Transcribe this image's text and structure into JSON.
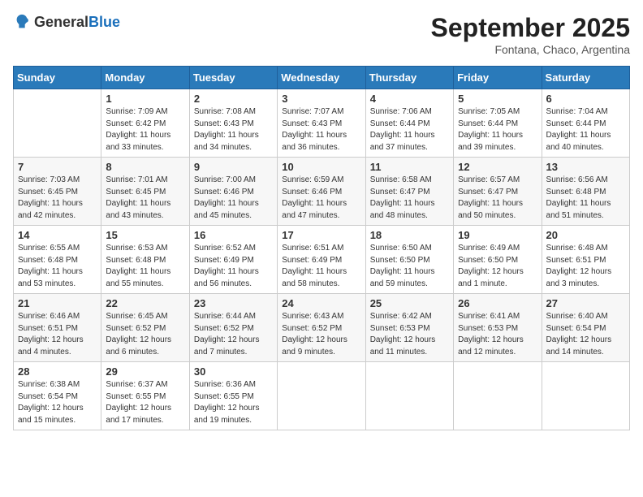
{
  "logo": {
    "general": "General",
    "blue": "Blue"
  },
  "title": "September 2025",
  "location": "Fontana, Chaco, Argentina",
  "days_of_week": [
    "Sunday",
    "Monday",
    "Tuesday",
    "Wednesday",
    "Thursday",
    "Friday",
    "Saturday"
  ],
  "weeks": [
    [
      {
        "day": "",
        "info": ""
      },
      {
        "day": "1",
        "info": "Sunrise: 7:09 AM\nSunset: 6:42 PM\nDaylight: 11 hours\nand 33 minutes."
      },
      {
        "day": "2",
        "info": "Sunrise: 7:08 AM\nSunset: 6:43 PM\nDaylight: 11 hours\nand 34 minutes."
      },
      {
        "day": "3",
        "info": "Sunrise: 7:07 AM\nSunset: 6:43 PM\nDaylight: 11 hours\nand 36 minutes."
      },
      {
        "day": "4",
        "info": "Sunrise: 7:06 AM\nSunset: 6:44 PM\nDaylight: 11 hours\nand 37 minutes."
      },
      {
        "day": "5",
        "info": "Sunrise: 7:05 AM\nSunset: 6:44 PM\nDaylight: 11 hours\nand 39 minutes."
      },
      {
        "day": "6",
        "info": "Sunrise: 7:04 AM\nSunset: 6:44 PM\nDaylight: 11 hours\nand 40 minutes."
      }
    ],
    [
      {
        "day": "7",
        "info": "Sunrise: 7:03 AM\nSunset: 6:45 PM\nDaylight: 11 hours\nand 42 minutes."
      },
      {
        "day": "8",
        "info": "Sunrise: 7:01 AM\nSunset: 6:45 PM\nDaylight: 11 hours\nand 43 minutes."
      },
      {
        "day": "9",
        "info": "Sunrise: 7:00 AM\nSunset: 6:46 PM\nDaylight: 11 hours\nand 45 minutes."
      },
      {
        "day": "10",
        "info": "Sunrise: 6:59 AM\nSunset: 6:46 PM\nDaylight: 11 hours\nand 47 minutes."
      },
      {
        "day": "11",
        "info": "Sunrise: 6:58 AM\nSunset: 6:47 PM\nDaylight: 11 hours\nand 48 minutes."
      },
      {
        "day": "12",
        "info": "Sunrise: 6:57 AM\nSunset: 6:47 PM\nDaylight: 11 hours\nand 50 minutes."
      },
      {
        "day": "13",
        "info": "Sunrise: 6:56 AM\nSunset: 6:48 PM\nDaylight: 11 hours\nand 51 minutes."
      }
    ],
    [
      {
        "day": "14",
        "info": "Sunrise: 6:55 AM\nSunset: 6:48 PM\nDaylight: 11 hours\nand 53 minutes."
      },
      {
        "day": "15",
        "info": "Sunrise: 6:53 AM\nSunset: 6:48 PM\nDaylight: 11 hours\nand 55 minutes."
      },
      {
        "day": "16",
        "info": "Sunrise: 6:52 AM\nSunset: 6:49 PM\nDaylight: 11 hours\nand 56 minutes."
      },
      {
        "day": "17",
        "info": "Sunrise: 6:51 AM\nSunset: 6:49 PM\nDaylight: 11 hours\nand 58 minutes."
      },
      {
        "day": "18",
        "info": "Sunrise: 6:50 AM\nSunset: 6:50 PM\nDaylight: 11 hours\nand 59 minutes."
      },
      {
        "day": "19",
        "info": "Sunrise: 6:49 AM\nSunset: 6:50 PM\nDaylight: 12 hours\nand 1 minute."
      },
      {
        "day": "20",
        "info": "Sunrise: 6:48 AM\nSunset: 6:51 PM\nDaylight: 12 hours\nand 3 minutes."
      }
    ],
    [
      {
        "day": "21",
        "info": "Sunrise: 6:46 AM\nSunset: 6:51 PM\nDaylight: 12 hours\nand 4 minutes."
      },
      {
        "day": "22",
        "info": "Sunrise: 6:45 AM\nSunset: 6:52 PM\nDaylight: 12 hours\nand 6 minutes."
      },
      {
        "day": "23",
        "info": "Sunrise: 6:44 AM\nSunset: 6:52 PM\nDaylight: 12 hours\nand 7 minutes."
      },
      {
        "day": "24",
        "info": "Sunrise: 6:43 AM\nSunset: 6:52 PM\nDaylight: 12 hours\nand 9 minutes."
      },
      {
        "day": "25",
        "info": "Sunrise: 6:42 AM\nSunset: 6:53 PM\nDaylight: 12 hours\nand 11 minutes."
      },
      {
        "day": "26",
        "info": "Sunrise: 6:41 AM\nSunset: 6:53 PM\nDaylight: 12 hours\nand 12 minutes."
      },
      {
        "day": "27",
        "info": "Sunrise: 6:40 AM\nSunset: 6:54 PM\nDaylight: 12 hours\nand 14 minutes."
      }
    ],
    [
      {
        "day": "28",
        "info": "Sunrise: 6:38 AM\nSunset: 6:54 PM\nDaylight: 12 hours\nand 15 minutes."
      },
      {
        "day": "29",
        "info": "Sunrise: 6:37 AM\nSunset: 6:55 PM\nDaylight: 12 hours\nand 17 minutes."
      },
      {
        "day": "30",
        "info": "Sunrise: 6:36 AM\nSunset: 6:55 PM\nDaylight: 12 hours\nand 19 minutes."
      },
      {
        "day": "",
        "info": ""
      },
      {
        "day": "",
        "info": ""
      },
      {
        "day": "",
        "info": ""
      },
      {
        "day": "",
        "info": ""
      }
    ]
  ]
}
